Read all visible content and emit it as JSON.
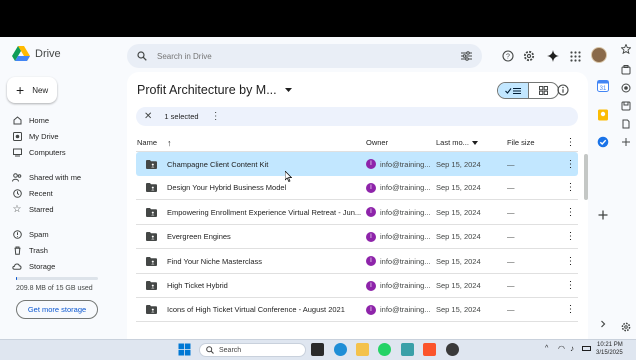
{
  "app": {
    "name": "Drive"
  },
  "search": {
    "placeholder": "Search in Drive"
  },
  "sidebar": {
    "new_label": "New",
    "items": [
      {
        "label": "Home",
        "icon": "home-icon"
      },
      {
        "label": "My Drive",
        "icon": "my-drive-icon"
      },
      {
        "label": "Computers",
        "icon": "computer-icon"
      },
      {
        "label": "Shared with me",
        "icon": "people-icon"
      },
      {
        "label": "Recent",
        "icon": "clock-icon"
      },
      {
        "label": "Starred",
        "icon": "star-icon"
      },
      {
        "label": "Spam",
        "icon": "spam-icon"
      },
      {
        "label": "Trash",
        "icon": "trash-icon"
      },
      {
        "label": "Storage",
        "icon": "cloud-icon"
      }
    ],
    "storage": {
      "used_text": "209.8 MB of 15 GB used",
      "used_fraction": 0.014,
      "button_label": "Get more storage"
    }
  },
  "main": {
    "folder_title": "Profit Architecture by M...",
    "selection_text": "1 selected",
    "columns": {
      "name": "Name",
      "owner": "Owner",
      "modified": "Last mo...",
      "size": "File size"
    },
    "rows": [
      {
        "name": "Champagne Client Content Kit",
        "owner_initial": "I",
        "owner": "info@training...",
        "modified": "Sep 15, 2024",
        "size": "—",
        "selected": true
      },
      {
        "name": "Design Your Hybrid Business Model",
        "owner_initial": "I",
        "owner": "info@training...",
        "modified": "Sep 15, 2024",
        "size": "—"
      },
      {
        "name": "Empowering Enrollment Experience Virtual Retreat - Jun...",
        "owner_initial": "I",
        "owner": "info@training...",
        "modified": "Sep 15, 2024",
        "size": "—"
      },
      {
        "name": "Evergreen Engines",
        "owner_initial": "I",
        "owner": "info@training...",
        "modified": "Sep 15, 2024",
        "size": "—"
      },
      {
        "name": "Find Your Niche Masterclass",
        "owner_initial": "I",
        "owner": "info@training...",
        "modified": "Sep 15, 2024",
        "size": "—"
      },
      {
        "name": "High Ticket Hybrid",
        "owner_initial": "I",
        "owner": "info@training...",
        "modified": "Sep 15, 2024",
        "size": "—"
      },
      {
        "name": "Icons of High Ticket Virtual Conference - August 2021",
        "owner_initial": "I",
        "owner": "info@training...",
        "modified": "Sep 15, 2024",
        "size": "—"
      }
    ]
  },
  "taskbar": {
    "search_label": "Search",
    "time": "10:21 PM",
    "date": "3/15/2025"
  },
  "colors": {
    "accent": "#0b57d0",
    "selected_row": "#c2e7ff",
    "owner_avatar": "#8e24aa"
  }
}
